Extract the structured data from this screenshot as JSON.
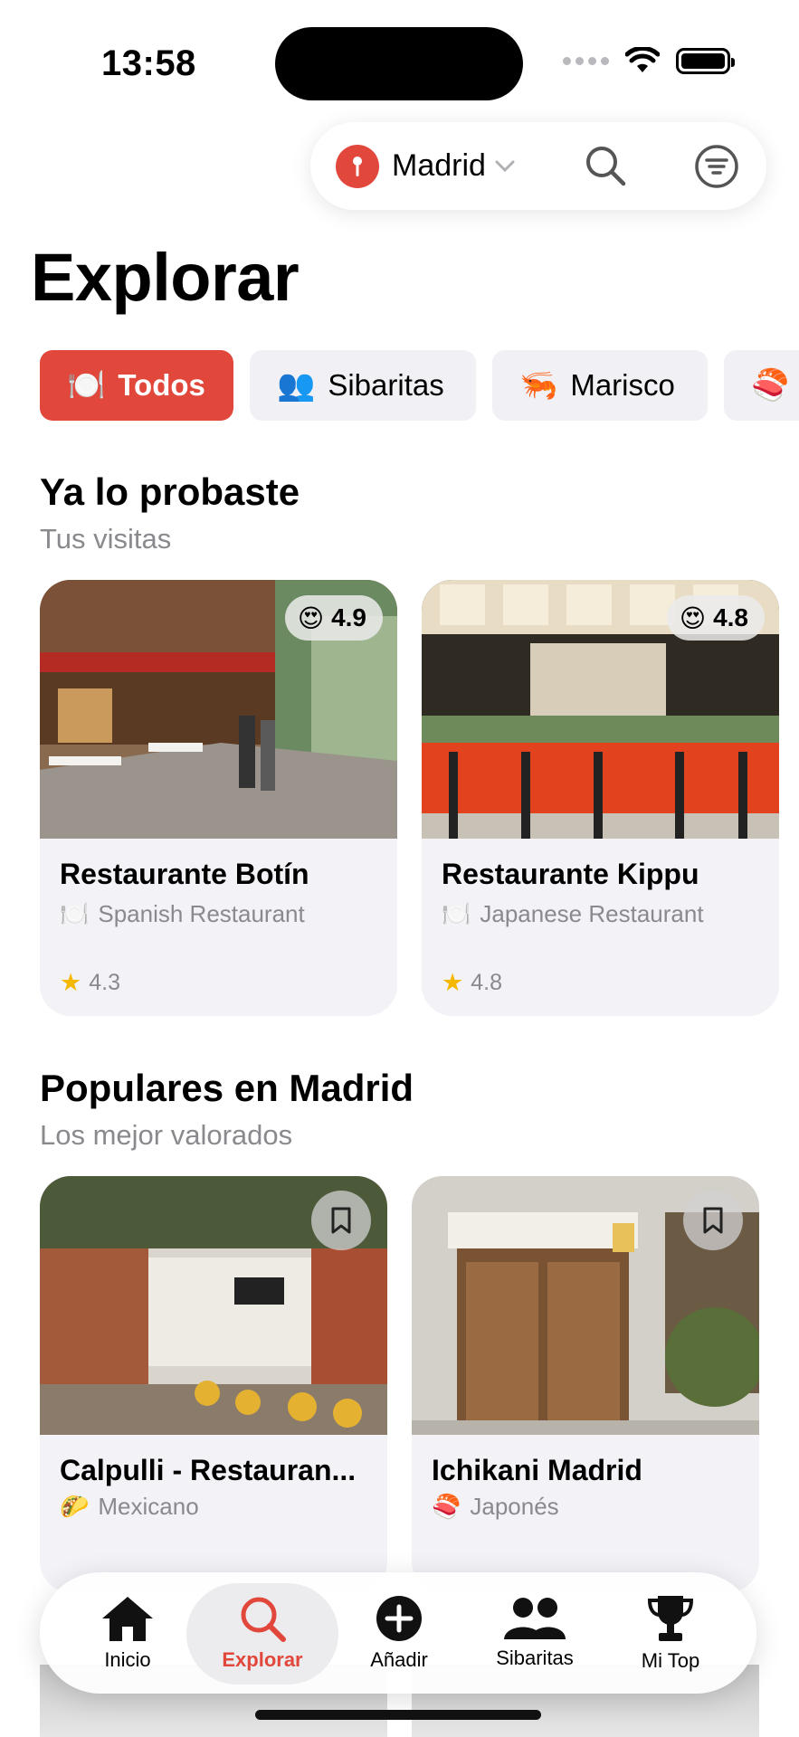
{
  "status_bar": {
    "time": "13:58"
  },
  "top_bar": {
    "city": "Madrid",
    "search_icon": "search-icon",
    "filter_icon": "filter-icon"
  },
  "page_title": "Explorar",
  "chips": [
    {
      "emoji": "🍽️",
      "label": "Todos",
      "active": true
    },
    {
      "emoji": "👥",
      "label": "Sibaritas",
      "active": false
    },
    {
      "emoji": "🦐",
      "label": "Marisco",
      "active": false
    },
    {
      "emoji": "🍣",
      "label": "",
      "active": false
    }
  ],
  "visited": {
    "title": "Ya lo probaste",
    "subtitle": "Tus visitas",
    "cards": [
      {
        "name": "Restaurante Botín",
        "category_emoji": "🍽️",
        "category": "Spanish Restaurant",
        "rating": "4.3",
        "score_emoji": "😍",
        "score": "4.9"
      },
      {
        "name": "Restaurante Kippu",
        "category_emoji": "🍽️",
        "category": "Japanese Restaurant",
        "rating": "4.8",
        "score_emoji": "😍",
        "score": "4.8"
      }
    ]
  },
  "popular": {
    "title": "Populares en Madrid",
    "subtitle": "Los mejor valorados",
    "cards": [
      {
        "name": "Calpulli - Restauran...",
        "category_emoji": "🌮",
        "category": "Mexicano"
      },
      {
        "name": "Ichikani Madrid",
        "category_emoji": "🍣",
        "category": "Japonés"
      }
    ]
  },
  "tab_bar": {
    "items": [
      {
        "label": "Inicio",
        "icon": "home-icon",
        "active": false
      },
      {
        "label": "Explorar",
        "icon": "search-icon",
        "active": true
      },
      {
        "label": "Añadir",
        "icon": "plus-circle-icon",
        "active": false
      },
      {
        "label": "Sibaritas",
        "icon": "people-icon",
        "active": false
      },
      {
        "label": "Mi Top",
        "icon": "trophy-icon",
        "active": false
      }
    ]
  },
  "colors": {
    "accent": "#e2473c",
    "card_bg": "#f2f2f7",
    "secondary_text": "#8a8a8e"
  }
}
